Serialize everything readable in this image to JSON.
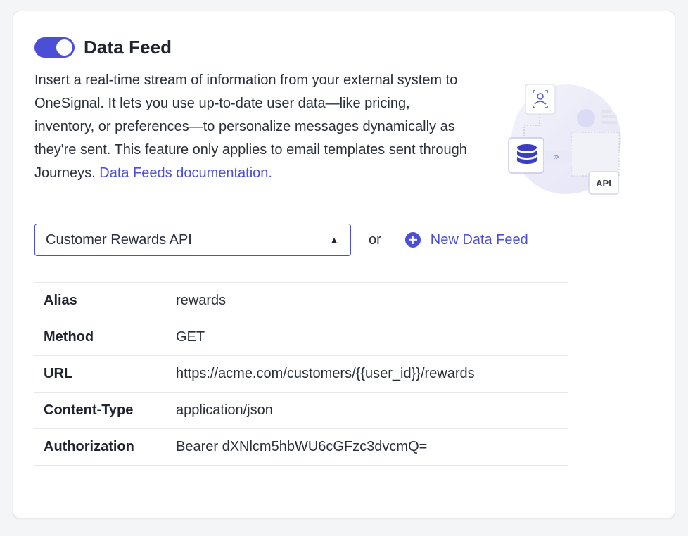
{
  "header": {
    "title": "Data Feed",
    "toggle_on": true
  },
  "description": {
    "text": "Insert a real-time stream of information from your external system to OneSignal. It lets you use up-to-date user data—like pricing, inventory, or preferences—to personalize messages dynamically as they're sent. This feature only applies to email templates sent through Journeys. ",
    "link_label": "Data Feeds documentation."
  },
  "illustration": {
    "api_label": "API",
    "arrows_label": "»"
  },
  "feed_select": {
    "selected": "Customer Rewards API"
  },
  "or_label": "or",
  "new_feed_label": "New Data Feed",
  "details": [
    {
      "key": "Alias",
      "value": "rewards"
    },
    {
      "key": "Method",
      "value": "GET"
    },
    {
      "key": "URL",
      "value": "https://acme.com/customers/{{user_id}}/rewards"
    },
    {
      "key": "Content-Type",
      "value": "application/json"
    },
    {
      "key": "Authorization",
      "value": "Bearer dXNlcm5hbWU6cGFzc3dvcmQ="
    }
  ],
  "colors": {
    "accent": "#4b4fd8",
    "background": "#f4f5f7",
    "card": "#ffffff"
  }
}
